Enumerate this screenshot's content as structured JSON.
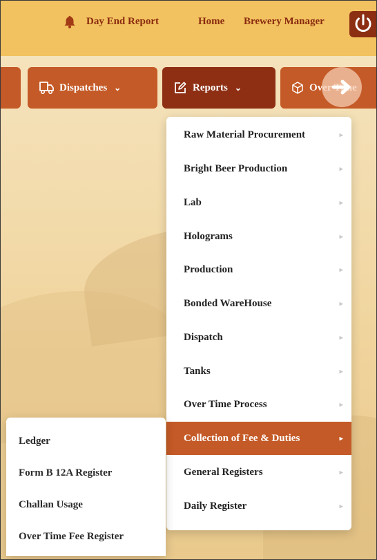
{
  "colors": {
    "header_bg": "#f2c260",
    "header_link": "#8a2b10",
    "tab_bg": "#c45a27",
    "tab_active_bg": "#8e2f14",
    "dropdown_active_bg": "#c45a27",
    "page_bg": "#f0d49d"
  },
  "header": {
    "links": [
      "Day End Report",
      "Home",
      "Brewery Manager"
    ],
    "icons": {
      "bell": "bell-icon",
      "power": "power-icon"
    }
  },
  "menubar": {
    "tabs": [
      {
        "label": "",
        "icon": ""
      },
      {
        "label": "Dispatches",
        "icon": "truck-icon"
      },
      {
        "label": "Reports",
        "icon": "edit-report-icon",
        "active": true
      },
      {
        "label": "Over Time",
        "icon": "box-icon"
      }
    ],
    "scroll_button_icon": "arrow-right-icon"
  },
  "reports_menu": {
    "items": [
      "Raw Material Procurement",
      "Bright Beer Production",
      "Lab",
      "Holograms",
      "Production",
      "Bonded WareHouse",
      "Dispatch",
      "Tanks",
      "Over Time Process",
      "Collection of Fee & Duties",
      "General Registers",
      "Daily Register"
    ],
    "active_item": "Collection of Fee & Duties"
  },
  "fee_duties_submenu": {
    "items": [
      "Ledger",
      "Form B 12A Register",
      "Challan Usage",
      "Over Time Fee Register"
    ]
  }
}
